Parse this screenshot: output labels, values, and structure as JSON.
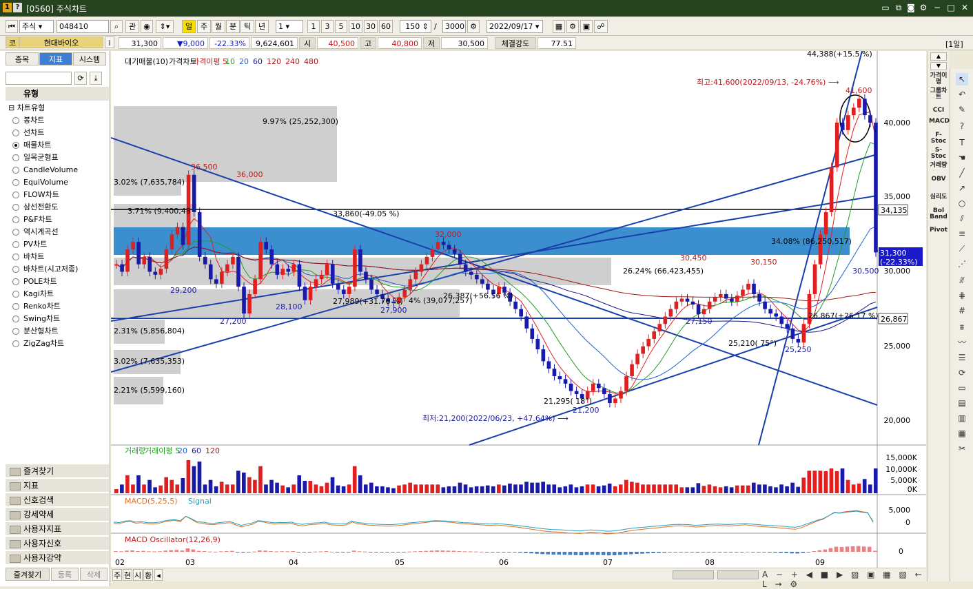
{
  "window": {
    "code": "[0560]",
    "title": "주식차트"
  },
  "toolbar": {
    "market": "주식",
    "code": "048410",
    "kwan": "관",
    "periods": [
      "일",
      "주",
      "월",
      "분",
      "틱",
      "년"
    ],
    "interval": "1",
    "quick": [
      "1",
      "3",
      "5",
      "10",
      "30",
      "60"
    ],
    "count": "150",
    "total": "3000",
    "date": "2022/09/17",
    "co": "코",
    "range": "[1일]"
  },
  "quote": {
    "name": "현대바이오",
    "price": "31,300",
    "change": "▼9,000",
    "rate": "-22.33%",
    "volume": "9,624,601",
    "open_lbl": "시",
    "open": "40,500",
    "high_lbl": "고",
    "high": "40,800",
    "low_lbl": "저",
    "low": "30,500",
    "strength_lbl": "체결강도",
    "strength": "77.51"
  },
  "left": {
    "tabs": [
      "종목",
      "지표",
      "시스템"
    ],
    "type_header": "유형",
    "tree_root": "차트유형",
    "chart_types": [
      "봉차트",
      "선차트",
      "매물차트",
      "일목균형표",
      "CandleVolume",
      "EquiVolume",
      "FLOW차트",
      "삼선전환도",
      "P&F차트",
      "역시계곡선",
      "PV차트",
      "바차트",
      "바차트(시고저종)",
      "POLE차트",
      "Kagi차트",
      "Renko차트",
      "Swing차트",
      "분산형차트",
      "ZigZag차트"
    ],
    "selected": "매물차트",
    "folders": [
      "즐겨찾기",
      "지표",
      "신호검색",
      "강세약세",
      "사용자지표",
      "사용자신호",
      "사용자강약"
    ],
    "bottom_tabs": [
      "즐겨찾기",
      "등록",
      "삭제"
    ]
  },
  "legend": {
    "main": [
      "대기매물(10)",
      "가격차트",
      "가격이평 5",
      "10",
      "20",
      "60",
      "120",
      "240",
      "480"
    ],
    "vol": [
      "거래량",
      "거래이평 5",
      "20",
      "60",
      "120"
    ],
    "macd": [
      "MACD(5,25,5)",
      "Signal"
    ],
    "osc": [
      "MACD Oscillator(12,26,9)"
    ]
  },
  "annotations": {
    "high": "최고:41,600(2022/09/13, -24.76%)",
    "low": "최저:21,200(2022/06/23, +47.64%)",
    "top_cut": "44,388(+15.5 %)",
    "price_labels": [
      "36,500",
      "36,000",
      "32,000",
      "30,450",
      "30,150",
      "41,600",
      "29,200",
      "28,100",
      "27,900",
      "27,200",
      "27,150",
      "25,250",
      "21,200",
      "30,500"
    ],
    "line_labels": [
      "33,860(-49.05 %)",
      "27,989(+31.76 %)",
      "26,387(+56.56 %)",
      "26,867(+26.17 %)",
      "25,210( 75°)",
      "21,295( 18°)"
    ],
    "profile": [
      {
        "pct": "9.97%",
        "vol": "(25,252,300)"
      },
      {
        "pct": "3.02%",
        "vol": "(7,635,784)"
      },
      {
        "pct": "3.71%",
        "vol": "(9,400,48"
      },
      {
        "pct": "34.08%",
        "vol": "(86,250,517)"
      },
      {
        "pct": "26.24%",
        "vol": "(66,423,455)"
      },
      {
        "pct": "4%",
        "vol": "(39,077,257)"
      },
      {
        "pct": "2.31%",
        "vol": "(5,856,804)"
      },
      {
        "pct": "3.02%",
        "vol": "(7,635,353)"
      },
      {
        "pct": "2.21%",
        "vol": "(5,599,160)"
      }
    ]
  },
  "axis": {
    "price": [
      "40,000",
      "35,000",
      "30,000",
      "25,000",
      "20,000"
    ],
    "vol": [
      "15,000K",
      "10,000K",
      "5,000K",
      "0K"
    ],
    "macd": [
      "5,000",
      "0"
    ],
    "osc": [
      "0"
    ],
    "months": [
      "02",
      "03",
      "04",
      "05",
      "06",
      "07",
      "08",
      "09"
    ],
    "price_tags": {
      "p1": "34,135",
      "p2": "26,867",
      "current": "31,300",
      "current_rate": "(-22.33%)"
    }
  },
  "bottom": {
    "buttons": [
      "주",
      "현",
      "시",
      "황"
    ]
  },
  "rightbar": [
    "가격이평",
    "그룹차트",
    "CCI",
    "MACD",
    "F-Stoc",
    "S-Stoc",
    "거래량",
    "OBV",
    "심리도",
    "Bol Band",
    "Pivot"
  ],
  "chart_data": {
    "type": "candlestick",
    "ylim": [
      19000,
      45000
    ],
    "candles": []
  }
}
